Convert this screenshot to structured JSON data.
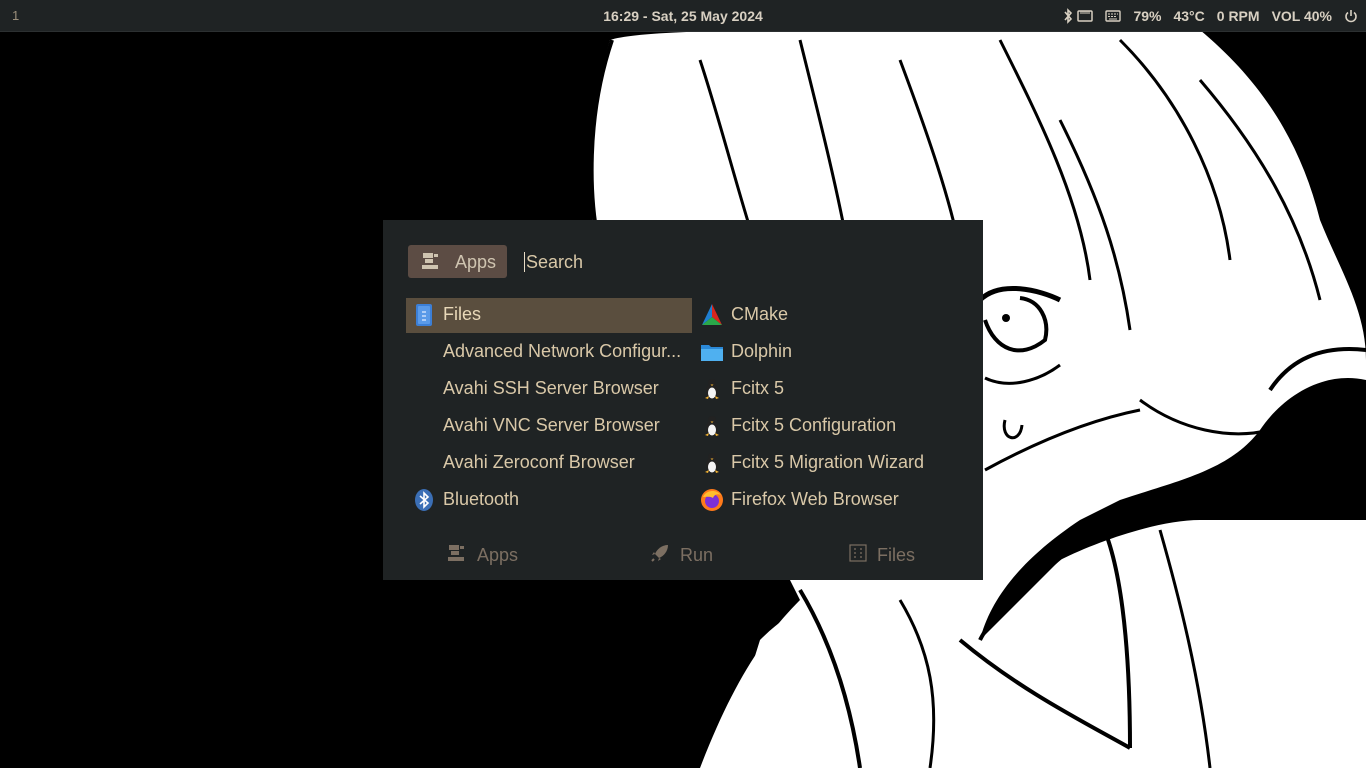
{
  "topbar": {
    "workspace": "1",
    "clock": "16:29 - Sat, 25 May 2024",
    "battery": "79%",
    "temperature": "43°C",
    "fan": "0 RPM",
    "volume": "VOL 40%"
  },
  "launcher": {
    "mode_label": "Apps",
    "search_placeholder": "Search",
    "left_items": [
      {
        "label": "Files",
        "icon": "files-icon"
      },
      {
        "label": "Advanced Network Configur...",
        "icon": ""
      },
      {
        "label": "Avahi SSH Server Browser",
        "icon": ""
      },
      {
        "label": "Avahi VNC Server Browser",
        "icon": ""
      },
      {
        "label": "Avahi Zeroconf Browser",
        "icon": ""
      },
      {
        "label": "Bluetooth",
        "icon": "bluetooth-icon"
      }
    ],
    "right_items": [
      {
        "label": "CMake",
        "icon": "cmake-icon"
      },
      {
        "label": "Dolphin",
        "icon": "dolphin-folder-icon"
      },
      {
        "label": "Fcitx 5",
        "icon": "tux-icon"
      },
      {
        "label": "Fcitx 5 Configuration",
        "icon": "tux-icon"
      },
      {
        "label": "Fcitx 5 Migration Wizard",
        "icon": "tux-icon"
      },
      {
        "label": "Firefox Web Browser",
        "icon": "firefox-icon"
      }
    ],
    "tabs": {
      "apps": "Apps",
      "run": "Run",
      "files": "Files"
    }
  },
  "colors": {
    "panel_bg": "#1f2324",
    "selected_bg": "#5a4e3e",
    "chip_bg": "#5c4c44",
    "text": "#d9c8a8",
    "muted": "#7c6f62"
  }
}
